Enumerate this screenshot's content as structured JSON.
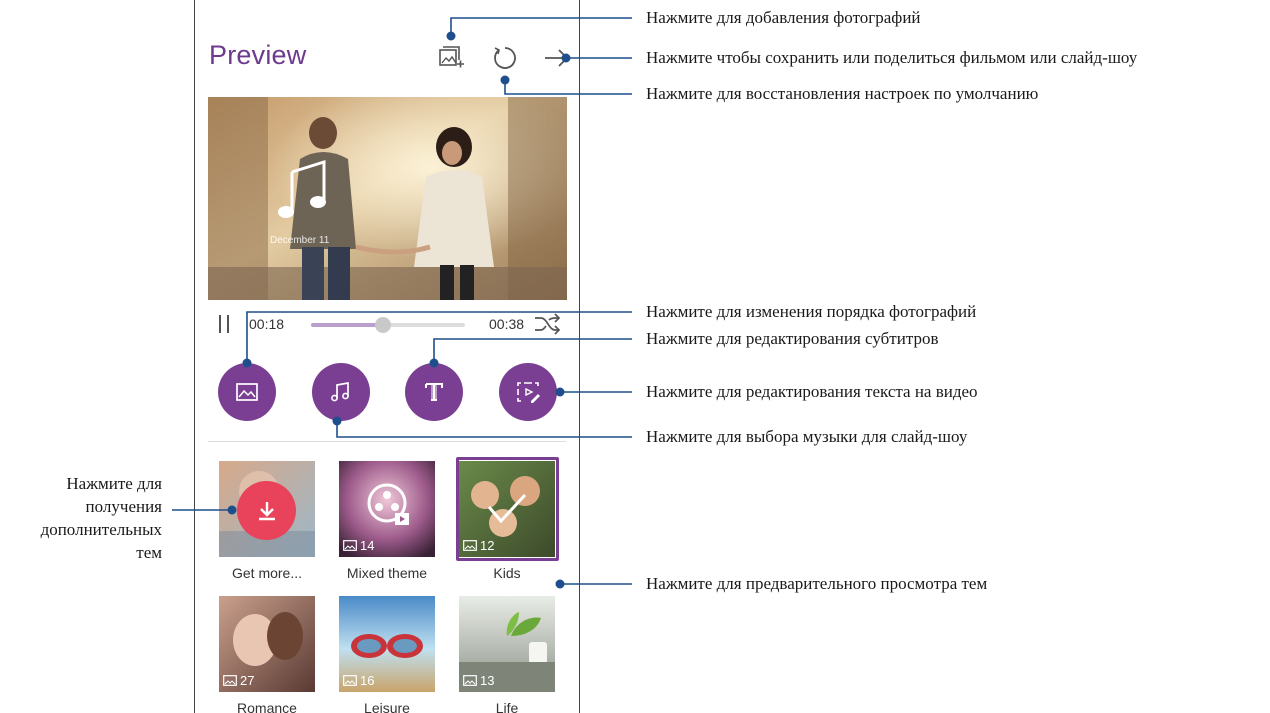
{
  "app": {
    "title": "Preview",
    "video_date": "December 11"
  },
  "icons": {
    "add_photos": "add-photo-icon",
    "reset": "reset-icon",
    "share": "arrow-right-icon",
    "pause": "pause-icon",
    "shuffle": "shuffle-icon",
    "edit_photos": "image-icon",
    "music": "music-note-icon",
    "subtitles": "text-t-icon",
    "text_on_video": "video-text-edit-icon",
    "download": "download-icon"
  },
  "player": {
    "current_time": "00:18",
    "total_time": "00:38",
    "progress": 0.47
  },
  "themes": [
    {
      "label": "Get more...",
      "count": ""
    },
    {
      "label": "Mixed theme",
      "count": "14"
    },
    {
      "label": "Kids",
      "count": "12",
      "selected": true
    },
    {
      "label": "Romance",
      "count": "27"
    },
    {
      "label": "Leisure",
      "count": "16"
    },
    {
      "label": "Life",
      "count": "13"
    }
  ],
  "callouts": {
    "add_photos": "Нажмите для добавления фотографий",
    "save_share": "Нажмите чтобы сохранить или поделиться фильмом или слайд-шоу",
    "reset_defaults": "Нажмите для восстановления настроек по умолчанию",
    "reorder_photos": "Нажмите для изменения порядка фотографий",
    "edit_subtitles": "Нажмите для редактирования субтитров",
    "edit_text": "Нажмите для редактирования текста на видео",
    "choose_music": "Нажмите для выбора музыки для слайд-шоу",
    "preview_themes": "Нажмите для предварительного просмотра тем",
    "more_themes": [
      "Нажмите для",
      "получения",
      "дополнительных",
      "тем"
    ]
  },
  "colors": {
    "accent": "#7a3f93",
    "title": "#6d3a8e",
    "download": "#e8435a",
    "callout_line": "#1f4e8c"
  }
}
